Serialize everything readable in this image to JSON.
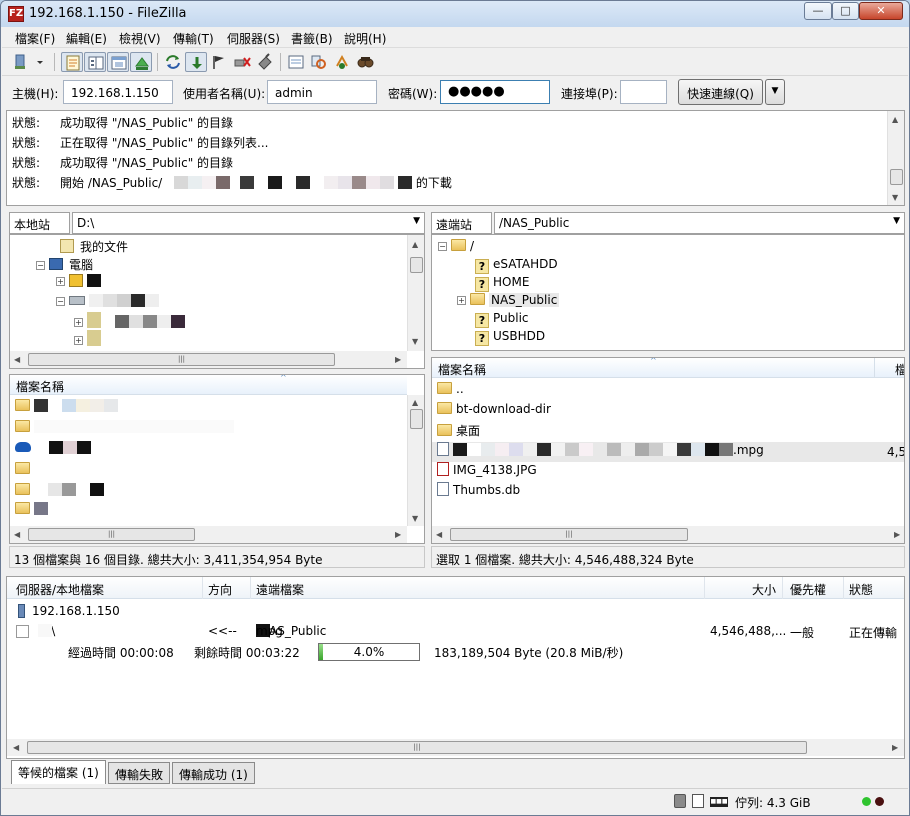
{
  "window": {
    "title": "192.168.1.150 - FileZilla",
    "app_icon_text": "FZ"
  },
  "menu": [
    "檔案(F)",
    "編輯(E)",
    "檢視(V)",
    "傳輸(T)",
    "伺服器(S)",
    "書籤(B)",
    "說明(H)"
  ],
  "quickconnect": {
    "host_label": "主機(H):",
    "host_value": "192.168.1.150",
    "user_label": "使用者名稱(U):",
    "user_value": "admin",
    "pass_label": "密碼(W):",
    "pass_value": "●●●●●",
    "port_label": "連接埠(P):",
    "port_value": "",
    "connect_label": "快速連線(Q)"
  },
  "log": [
    {
      "type": "狀態:",
      "text": "成功取得 \"/NAS_Public\" 的目錄"
    },
    {
      "type": "狀態:",
      "text": "正在取得 \"/NAS_Public\" 的目錄列表..."
    },
    {
      "type": "狀態:",
      "text": "成功取得 \"/NAS_Public\" 的目錄"
    },
    {
      "type": "狀態:",
      "text": "開始 /NAS_Public/",
      "suffix": "的下載"
    }
  ],
  "local": {
    "site_label": "本地站台:",
    "site_path": "D:\\",
    "tree": {
      "documents": "我的文件",
      "computer": "電腦"
    },
    "column_name": "檔案名稱",
    "status": "13 個檔案與 16 個目錄. 總共大小: 3,411,354,954 Byte"
  },
  "remote": {
    "site_label": "遠端站台:",
    "site_path": "/NAS_Public",
    "tree": {
      "root": "/",
      "items": [
        "eSATAHDD",
        "HOME",
        "NAS_Public",
        "Public",
        "USBHDD"
      ]
    },
    "column_name": "檔案名稱",
    "column_size": "檔",
    "files": {
      "up": "..",
      "dir1": "bt-download-dir",
      "dir2": "桌面",
      "mpg_ext": ".mpg",
      "mpg_size": "4,5",
      "jpg": "IMG_4138.JPG",
      "db": "Thumbs.db"
    },
    "status": "選取 1 個檔案. 總共大小: 4,546,488,324 Byte"
  },
  "queue": {
    "headers": {
      "server_local": "伺服器/本地檔案",
      "direction": "方向",
      "remote": "遠端檔案",
      "size": "大小",
      "priority": "優先權",
      "status": "狀態"
    },
    "server": "192.168.1.150",
    "item": {
      "local": "D:\\",
      "direction": "<<--",
      "remote_prefix": "/NAS_Public",
      "remote_ext": "mpg",
      "size": "4,546,488,...",
      "priority": "一般",
      "status": "正在傳輸"
    },
    "progress": {
      "elapsed": "經過時間 00:00:08",
      "remaining": "剩餘時間 00:03:22",
      "percent": "4.0%",
      "fraction": 0.04,
      "bytes": "183,189,504 Byte (20.8 MiB/秒)"
    }
  },
  "tabs": [
    "等候的檔案 (1)",
    "傳輸失敗",
    "傳輸成功 (1)"
  ],
  "statusbar": {
    "queue": "佇列: 4.3 GiB"
  },
  "colors": {
    "led_green": "#2fc42f",
    "led_red": "#4a1010",
    "progress_fill": "#3aa52c"
  }
}
